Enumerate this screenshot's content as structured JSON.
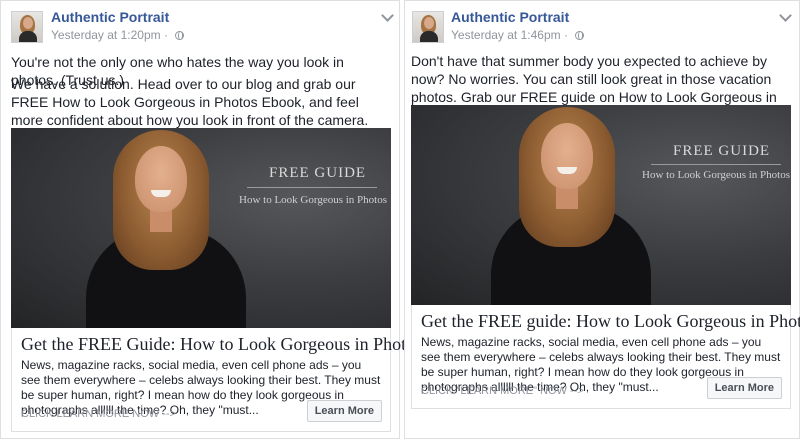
{
  "posts": [
    {
      "page_name": "Authentic Portrait",
      "timestamp": "Yesterday at 1:20pm",
      "paragraphs": [
        "You're not the only one who hates the way you look in photos. (Trust us.)",
        "We have a solution. Head over to our blog and grab our FREE How to Look Gorgeous in Photos Ebook, and feel more confident about how you look in front of the camera."
      ],
      "image_overlay": {
        "title": "FREE GUIDE",
        "subtitle": "How to Look Gorgeous in Photos"
      },
      "link_title": "Get the FREE Guide: How to Look Gorgeous in Photos",
      "link_description": "News, magazine racks, social media, even cell phone ads – you see them everywhere – celebs always looking their best.  They must be super human, right? I mean how do they look gorgeous in photographs allllll the time? Oh, they \"must...",
      "cta_text": "CLICK LEARN MORE NOW -->",
      "button_label": "Learn More"
    },
    {
      "page_name": "Authentic Portrait",
      "timestamp": "Yesterday at 1:46pm",
      "paragraphs": [
        "Don't have that summer body you expected to achieve by now? No worries. You can still look great in those vacation photos. Grab our FREE guide on How to Look Gorgeous in Photos."
      ],
      "image_overlay": {
        "title": "FREE GUIDE",
        "subtitle": "How to Look Gorgeous in Photos"
      },
      "link_title": "Get the FREE guide: How to Look Gorgeous in Photos",
      "link_description": "News, magazine racks, social media, even cell phone ads – you see them everywhere – celebs always looking their best.  They must be super human, right? I mean how do they look gorgeous in photographs allllll the time? Oh, they \"must...",
      "cta_text": "CLICK \"LEARN MORE\" NOW -->",
      "button_label": "Learn More"
    }
  ],
  "colors": {
    "link_blue": "#365899",
    "meta_gray": "#90949c",
    "text": "#1d2129",
    "border": "#dddfe2"
  },
  "icons": [
    "globe-icon",
    "chevron-down-icon"
  ]
}
